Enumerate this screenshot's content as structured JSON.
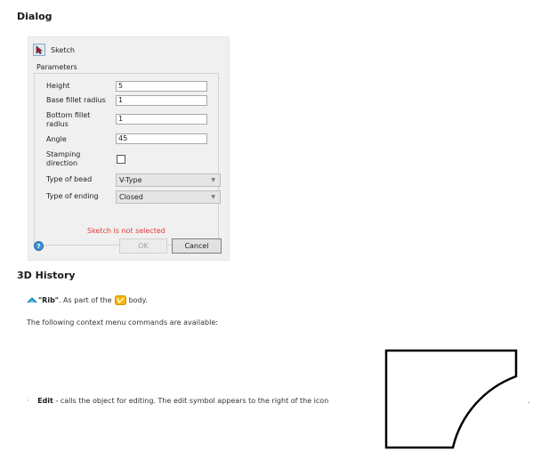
{
  "headings": {
    "dialog": "Dialog",
    "history": "3D History"
  },
  "dialog": {
    "sketch_label": "Sketch",
    "parameters_title": "Parameters",
    "fields": {
      "height": {
        "label": "Height",
        "value": "5"
      },
      "base_fillet": {
        "label": "Base fillet radius",
        "value": "1"
      },
      "bottom_fillet": {
        "label_line1": "Bottom fillet",
        "label_line2": "radius",
        "value": "1"
      },
      "angle": {
        "label": "Angle",
        "value": "45"
      },
      "stamping": {
        "label_line1": "Stamping",
        "label_line2": "direction",
        "checked": false
      },
      "bead_type": {
        "label": "Type of bead",
        "value": "V-Type"
      },
      "ending_type": {
        "label": "Type of ending",
        "value": "Closed"
      }
    },
    "error_text": "Sketch is not selected",
    "ok_label": "OK",
    "cancel_label": "Cancel",
    "help_glyph": "?"
  },
  "history": {
    "rib_name": "\"Rib\"",
    "rib_text_mid": ". As part of the",
    "rib_text_end": "body.",
    "context_text": "The following context menu commands are available:",
    "edit_bullet": "·",
    "edit_label": "Edit",
    "edit_text": " - calls the object for editing. The edit symbol appears to the right of the icon",
    "tail": "."
  },
  "icons": {
    "sketch": "cursor-arrow-icon",
    "help": "help-icon",
    "rib": "rib-icon",
    "body": "body-icon",
    "chevron": "chevron-down-icon"
  },
  "colors": {
    "error": "#e23a3a",
    "help": "#3e8fd6",
    "rib": "#1f8fc4",
    "body": "#f2b705"
  }
}
